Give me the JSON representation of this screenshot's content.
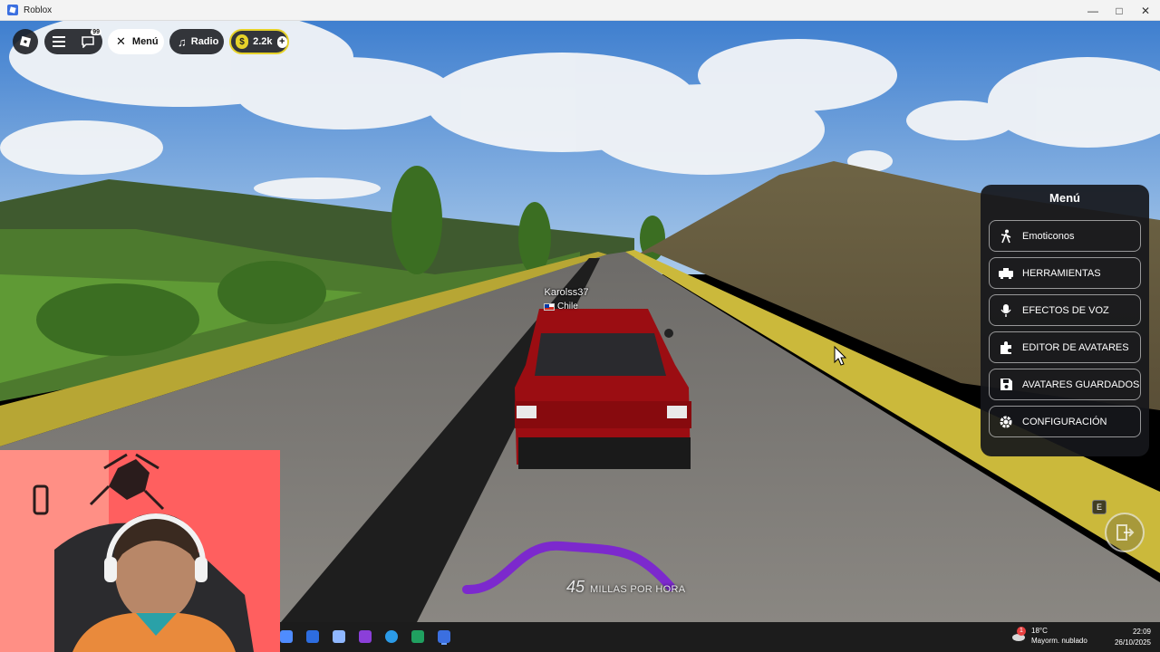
{
  "window": {
    "title": "Roblox"
  },
  "hud": {
    "chat_badge": "99",
    "menu_label": "Menú",
    "radio_label": "Radio",
    "currency": "2.2k",
    "add_symbol": "+"
  },
  "side_menu": {
    "title": "Menú",
    "items": [
      {
        "label": "Emoticonos",
        "icon": "emote-figure-icon"
      },
      {
        "label": "HERRAMIENTAS",
        "icon": "tools-icon"
      },
      {
        "label": "EFECTOS DE VOZ",
        "icon": "microphone-icon"
      },
      {
        "label": "EDITOR DE AVATARES",
        "icon": "puzzle-icon"
      },
      {
        "label": "AVATARES GUARDADOS",
        "icon": "save-icon"
      },
      {
        "label": "CONFIGURACIÓN",
        "icon": "gear-icon"
      }
    ]
  },
  "player": {
    "name": "Karolss37",
    "country": "Chile"
  },
  "interaction": {
    "key": "E"
  },
  "speedometer": {
    "value": "45",
    "unit": "MILLAS POR HORA"
  },
  "taskbar": {
    "weather_temp": "18°C",
    "weather_desc": "Mayorm. nublado",
    "weather_alert": "1",
    "time": "22:09",
    "date": "26/10/2025"
  },
  "colors": {
    "hud_bg": "#191b20",
    "currency_ring": "#e6d22a",
    "menu_bg": "#16171b",
    "car": "#9b0d12",
    "curb": "#c9b93a",
    "speed_arc": "#7b1fd6"
  }
}
